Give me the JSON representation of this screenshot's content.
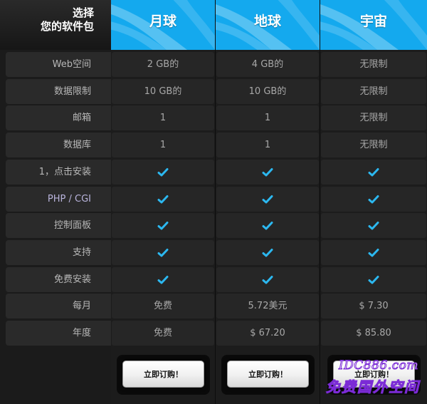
{
  "corner": {
    "line1": "选择",
    "line2": "您的软件包"
  },
  "plans": [
    {
      "name": "月球"
    },
    {
      "name": "地球"
    },
    {
      "name": "宇宙"
    }
  ],
  "rows": [
    {
      "label": "Web空间",
      "values": [
        "2 GB的",
        "4 GB的",
        "无限制"
      ]
    },
    {
      "label": "数据限制",
      "values": [
        "10 GB的",
        "10 GB的",
        "无限制"
      ]
    },
    {
      "label": "邮箱",
      "values": [
        "1",
        "1",
        "无限制"
      ]
    },
    {
      "label": "数据库",
      "values": [
        "1",
        "1",
        "无限制"
      ]
    },
    {
      "label": "1，点击安装",
      "values": [
        "check",
        "check",
        "check"
      ]
    },
    {
      "label": "PHP / CGI",
      "values": [
        "check",
        "check",
        "check"
      ]
    },
    {
      "label": "控制面板",
      "values": [
        "check",
        "check",
        "check"
      ]
    },
    {
      "label": "支持",
      "values": [
        "check",
        "check",
        "check"
      ]
    },
    {
      "label": "免费安装",
      "values": [
        "check",
        "check",
        "check"
      ]
    },
    {
      "label": "每月",
      "values": [
        "免费",
        "5.72美元",
        "$ 7.30"
      ]
    },
    {
      "label": "年度",
      "values": [
        "免费",
        "$ 67.20",
        "$ 85.80"
      ]
    }
  ],
  "buy_button": {
    "label": "立即订购！"
  },
  "watermark": {
    "line1": "IDC886.com",
    "line2": "免费国外空间"
  },
  "colors": {
    "header_blue": "#14a9ee",
    "check_blue": "#2cb8f0",
    "page_bg": "#0d0d0d"
  },
  "icons": {
    "included": "checkmark-icon"
  }
}
